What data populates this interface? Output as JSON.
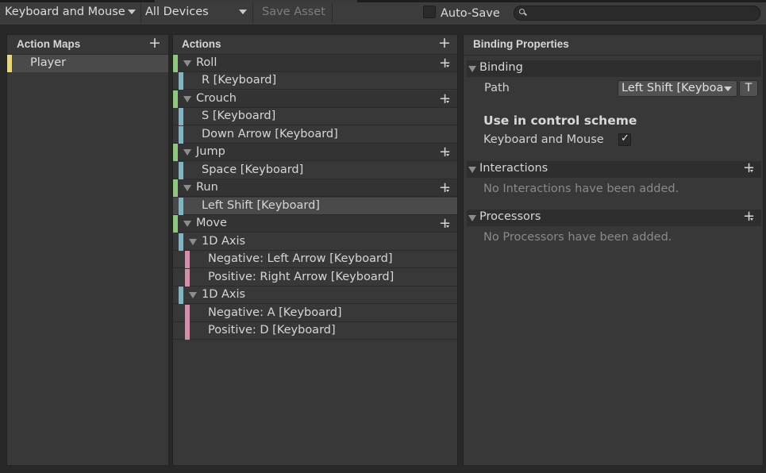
{
  "toolbar": {
    "control_scheme": "Keyboard and Mouse",
    "devices": "All Devices",
    "save_asset": "Save Asset",
    "auto_save_label": "Auto-Save",
    "auto_save_checked": false,
    "search_placeholder": ""
  },
  "action_maps": {
    "title": "Action Maps",
    "items": [
      {
        "label": "Player",
        "selected": true,
        "color": "#e9d77e"
      }
    ]
  },
  "actions": {
    "title": "Actions",
    "rows": [
      {
        "label": "Roll",
        "kind": "action"
      },
      {
        "label": "R [Keyboard]",
        "kind": "binding"
      },
      {
        "label": "Crouch",
        "kind": "action"
      },
      {
        "label": "S [Keyboard]",
        "kind": "binding"
      },
      {
        "label": "Down Arrow [Keyboard]",
        "kind": "binding"
      },
      {
        "label": "Jump",
        "kind": "action"
      },
      {
        "label": "Space [Keyboard]",
        "kind": "binding"
      },
      {
        "label": "Run",
        "kind": "action"
      },
      {
        "label": "Left Shift [Keyboard]",
        "kind": "binding",
        "selected": true
      },
      {
        "label": "Move",
        "kind": "action"
      },
      {
        "label": "1D Axis",
        "kind": "composite"
      },
      {
        "label": "Negative: Left Arrow [Keyboard]",
        "kind": "part"
      },
      {
        "label": "Positive: Right Arrow [Keyboard]",
        "kind": "part"
      },
      {
        "label": "1D Axis",
        "kind": "composite"
      },
      {
        "label": "Negative: A [Keyboard]",
        "kind": "part"
      },
      {
        "label": "Positive: D [Keyboard]",
        "kind": "part"
      }
    ],
    "colors": {
      "action": "#8ec57f",
      "binding": "#82b3c2",
      "part": "#d58eaa"
    }
  },
  "binding_properties": {
    "title": "Binding Properties",
    "binding_section": "Binding",
    "path_label": "Path",
    "path_value": "Left Shift [Keyboa",
    "t_button": "T",
    "use_in_scheme_heading": "Use in control scheme",
    "scheme_name": "Keyboard and Mouse",
    "scheme_checked": true,
    "interactions_section": "Interactions",
    "interactions_empty": "No Interactions have been added.",
    "processors_section": "Processors",
    "processors_empty": "No Processors have been added."
  }
}
